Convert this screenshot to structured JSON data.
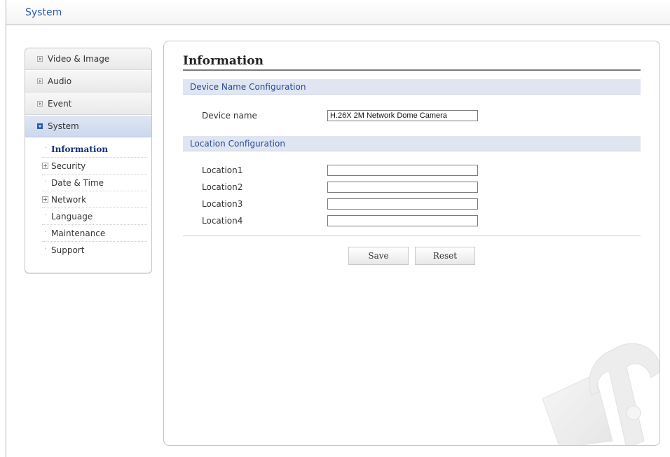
{
  "app": {
    "title": "System"
  },
  "sidebar": {
    "sections": [
      {
        "label": "Video & Image",
        "active": false
      },
      {
        "label": "Audio",
        "active": false
      },
      {
        "label": "Event",
        "active": false
      },
      {
        "label": "System",
        "active": true
      }
    ],
    "subitems": [
      {
        "label": "Information",
        "type": "leaf",
        "current": true
      },
      {
        "label": "Security",
        "type": "expandable"
      },
      {
        "label": "Date & Time",
        "type": "leaf"
      },
      {
        "label": "Network",
        "type": "expandable"
      },
      {
        "label": "Language",
        "type": "leaf"
      },
      {
        "label": "Maintenance",
        "type": "leaf"
      },
      {
        "label": "Support",
        "type": "leaf"
      }
    ]
  },
  "main": {
    "title": "Information",
    "device_section": {
      "heading": "Device Name Configuration",
      "device_name_label": "Device name",
      "device_name_value": "H.26X 2M Network Dome Camera"
    },
    "location_section": {
      "heading": "Location Configuration",
      "fields": [
        {
          "label": "Location1",
          "value": ""
        },
        {
          "label": "Location2",
          "value": ""
        },
        {
          "label": "Location3",
          "value": ""
        },
        {
          "label": "Location4",
          "value": ""
        }
      ]
    },
    "buttons": {
      "save": "Save",
      "reset": "Reset"
    }
  },
  "icons": {
    "collapsed": "expand-arrow-icon",
    "expanded": "collapse-arrow-icon",
    "expandable_subitem": "plus-box-icon",
    "leaf_subitem": "dot-icon",
    "decoration": "tools-watermark-icon"
  },
  "colors": {
    "accent": "#2a5cae",
    "band": "#dfe5f1",
    "band_text": "#2a4a93",
    "current_item": "#15307a"
  }
}
